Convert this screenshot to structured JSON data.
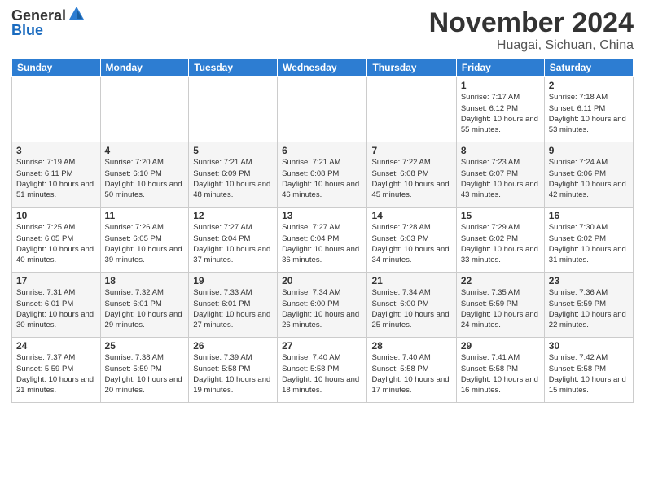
{
  "logo": {
    "general": "General",
    "blue": "Blue"
  },
  "header": {
    "month": "November 2024",
    "location": "Huagai, Sichuan, China"
  },
  "weekdays": [
    "Sunday",
    "Monday",
    "Tuesday",
    "Wednesday",
    "Thursday",
    "Friday",
    "Saturday"
  ],
  "rows": [
    [
      {
        "day": "",
        "info": ""
      },
      {
        "day": "",
        "info": ""
      },
      {
        "day": "",
        "info": ""
      },
      {
        "day": "",
        "info": ""
      },
      {
        "day": "",
        "info": ""
      },
      {
        "day": "1",
        "info": "Sunrise: 7:17 AM\nSunset: 6:12 PM\nDaylight: 10 hours and 55 minutes."
      },
      {
        "day": "2",
        "info": "Sunrise: 7:18 AM\nSunset: 6:11 PM\nDaylight: 10 hours and 53 minutes."
      }
    ],
    [
      {
        "day": "3",
        "info": "Sunrise: 7:19 AM\nSunset: 6:11 PM\nDaylight: 10 hours and 51 minutes."
      },
      {
        "day": "4",
        "info": "Sunrise: 7:20 AM\nSunset: 6:10 PM\nDaylight: 10 hours and 50 minutes."
      },
      {
        "day": "5",
        "info": "Sunrise: 7:21 AM\nSunset: 6:09 PM\nDaylight: 10 hours and 48 minutes."
      },
      {
        "day": "6",
        "info": "Sunrise: 7:21 AM\nSunset: 6:08 PM\nDaylight: 10 hours and 46 minutes."
      },
      {
        "day": "7",
        "info": "Sunrise: 7:22 AM\nSunset: 6:08 PM\nDaylight: 10 hours and 45 minutes."
      },
      {
        "day": "8",
        "info": "Sunrise: 7:23 AM\nSunset: 6:07 PM\nDaylight: 10 hours and 43 minutes."
      },
      {
        "day": "9",
        "info": "Sunrise: 7:24 AM\nSunset: 6:06 PM\nDaylight: 10 hours and 42 minutes."
      }
    ],
    [
      {
        "day": "10",
        "info": "Sunrise: 7:25 AM\nSunset: 6:05 PM\nDaylight: 10 hours and 40 minutes."
      },
      {
        "day": "11",
        "info": "Sunrise: 7:26 AM\nSunset: 6:05 PM\nDaylight: 10 hours and 39 minutes."
      },
      {
        "day": "12",
        "info": "Sunrise: 7:27 AM\nSunset: 6:04 PM\nDaylight: 10 hours and 37 minutes."
      },
      {
        "day": "13",
        "info": "Sunrise: 7:27 AM\nSunset: 6:04 PM\nDaylight: 10 hours and 36 minutes."
      },
      {
        "day": "14",
        "info": "Sunrise: 7:28 AM\nSunset: 6:03 PM\nDaylight: 10 hours and 34 minutes."
      },
      {
        "day": "15",
        "info": "Sunrise: 7:29 AM\nSunset: 6:02 PM\nDaylight: 10 hours and 33 minutes."
      },
      {
        "day": "16",
        "info": "Sunrise: 7:30 AM\nSunset: 6:02 PM\nDaylight: 10 hours and 31 minutes."
      }
    ],
    [
      {
        "day": "17",
        "info": "Sunrise: 7:31 AM\nSunset: 6:01 PM\nDaylight: 10 hours and 30 minutes."
      },
      {
        "day": "18",
        "info": "Sunrise: 7:32 AM\nSunset: 6:01 PM\nDaylight: 10 hours and 29 minutes."
      },
      {
        "day": "19",
        "info": "Sunrise: 7:33 AM\nSunset: 6:01 PM\nDaylight: 10 hours and 27 minutes."
      },
      {
        "day": "20",
        "info": "Sunrise: 7:34 AM\nSunset: 6:00 PM\nDaylight: 10 hours and 26 minutes."
      },
      {
        "day": "21",
        "info": "Sunrise: 7:34 AM\nSunset: 6:00 PM\nDaylight: 10 hours and 25 minutes."
      },
      {
        "day": "22",
        "info": "Sunrise: 7:35 AM\nSunset: 5:59 PM\nDaylight: 10 hours and 24 minutes."
      },
      {
        "day": "23",
        "info": "Sunrise: 7:36 AM\nSunset: 5:59 PM\nDaylight: 10 hours and 22 minutes."
      }
    ],
    [
      {
        "day": "24",
        "info": "Sunrise: 7:37 AM\nSunset: 5:59 PM\nDaylight: 10 hours and 21 minutes."
      },
      {
        "day": "25",
        "info": "Sunrise: 7:38 AM\nSunset: 5:59 PM\nDaylight: 10 hours and 20 minutes."
      },
      {
        "day": "26",
        "info": "Sunrise: 7:39 AM\nSunset: 5:58 PM\nDaylight: 10 hours and 19 minutes."
      },
      {
        "day": "27",
        "info": "Sunrise: 7:40 AM\nSunset: 5:58 PM\nDaylight: 10 hours and 18 minutes."
      },
      {
        "day": "28",
        "info": "Sunrise: 7:40 AM\nSunset: 5:58 PM\nDaylight: 10 hours and 17 minutes."
      },
      {
        "day": "29",
        "info": "Sunrise: 7:41 AM\nSunset: 5:58 PM\nDaylight: 10 hours and 16 minutes."
      },
      {
        "day": "30",
        "info": "Sunrise: 7:42 AM\nSunset: 5:58 PM\nDaylight: 10 hours and 15 minutes."
      }
    ]
  ]
}
